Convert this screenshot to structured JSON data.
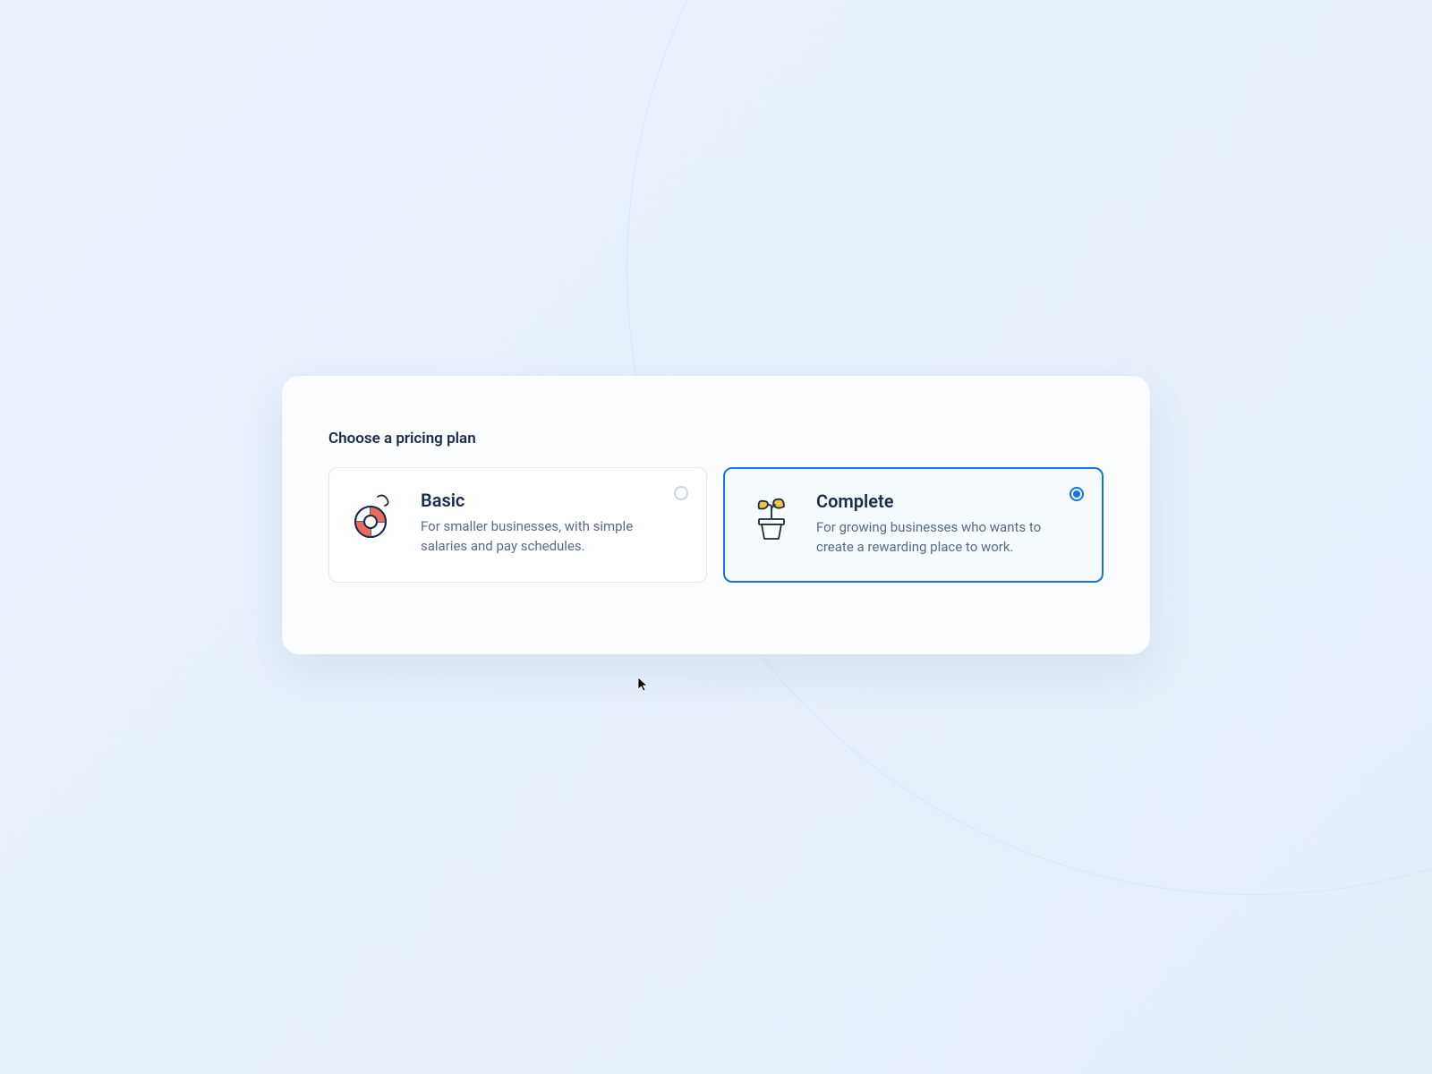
{
  "heading": "Choose a pricing plan",
  "plans": [
    {
      "id": "basic",
      "title": "Basic",
      "description": "For smaller businesses, with simple salaries and pay schedules.",
      "icon": "lifebuoy-icon",
      "selected": false
    },
    {
      "id": "complete",
      "title": "Complete",
      "description": "For growing businesses who wants to create a rewarding place to work.",
      "icon": "potted-plant-icon",
      "selected": true
    }
  ],
  "colors": {
    "accent": "#1473e6",
    "text_primary": "#1b2b4b",
    "text_secondary": "#5b6b85",
    "border": "#e2e8ee",
    "bg_selected": "#f5fbff"
  }
}
